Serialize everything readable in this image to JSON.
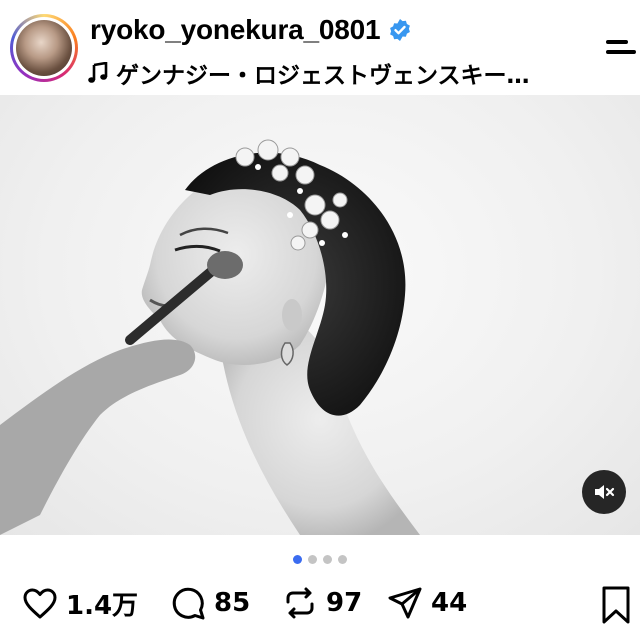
{
  "header": {
    "username": "ryoko_yonekura_0801",
    "audio_label": "ゲンナジー・ロジェストヴェンスキー…"
  },
  "post": {
    "photo_alt": "Black and white photo of a woman with eyes closed having makeup applied, hair adorned with floral ornaments",
    "carousel": {
      "count": 4,
      "active_index": 0
    }
  },
  "actions": {
    "likes": "1.4万",
    "comments": "85",
    "reposts": "97",
    "shares": "44"
  },
  "colors": {
    "verified": "#3897f0",
    "carousel_active": "#3b6cf0",
    "carousel_inactive": "#c4c4c4"
  }
}
